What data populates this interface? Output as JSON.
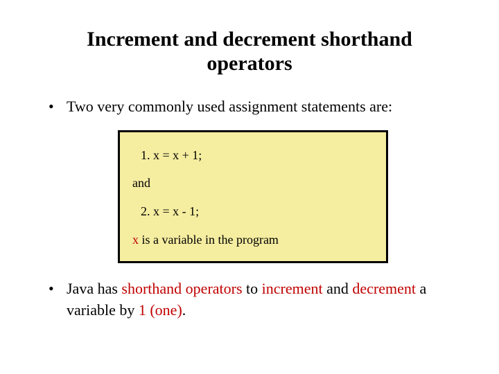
{
  "title_line1": "Increment and decrement shorthand",
  "title_line2": "operators",
  "bullet1": "Two very commonly used assignment statements are:",
  "codebox": {
    "line1": "1.   x = x + 1;",
    "and": "and",
    "line2": "2.   x = x - 1;",
    "footnote_prefix": "x",
    "footnote_rest": " is a variable in the program"
  },
  "bullet2": {
    "a": "Java has ",
    "b": "shorthand operators",
    "c": " to ",
    "d": "increment",
    "e": " and ",
    "f": "decrement",
    "g": " a variable by ",
    "h": "1 (one)",
    "i": "."
  }
}
